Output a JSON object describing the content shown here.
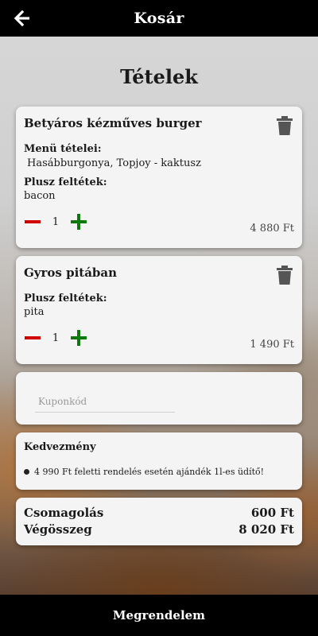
{
  "header": {
    "title": "Kosár",
    "back_icon": "arrow-left-icon"
  },
  "page_title": "Tételek",
  "colors": {
    "minus": "#d10000",
    "plus": "#0b7a0b",
    "bar": "#000000"
  },
  "cart_items": [
    {
      "name": "Betyáros kézműves burger",
      "menu_label": "Menü tételei:",
      "menu_value": "Hasábburgonya, Topjoy - kaktusz",
      "extras_label": "Plusz feltétek:",
      "extras_value": "bacon",
      "quantity": "1",
      "price": "4 880 Ft"
    },
    {
      "name": "Gyros pitában",
      "extras_label": "Plusz feltétek:",
      "extras_value": "pita",
      "quantity": "1",
      "price": "1 490 Ft"
    }
  ],
  "coupon": {
    "placeholder": "Kuponkód",
    "value": ""
  },
  "discount": {
    "title": "Kedvezmény",
    "text": "4 990 Ft feletti rendelés esetén ajándék 1l-es üdítő!"
  },
  "summary": {
    "packaging_label": "Csomagolás",
    "packaging_value": "600 Ft",
    "total_label": "Végösszeg",
    "total_value": "8 020 Ft"
  },
  "order_button": "Megrendelem"
}
